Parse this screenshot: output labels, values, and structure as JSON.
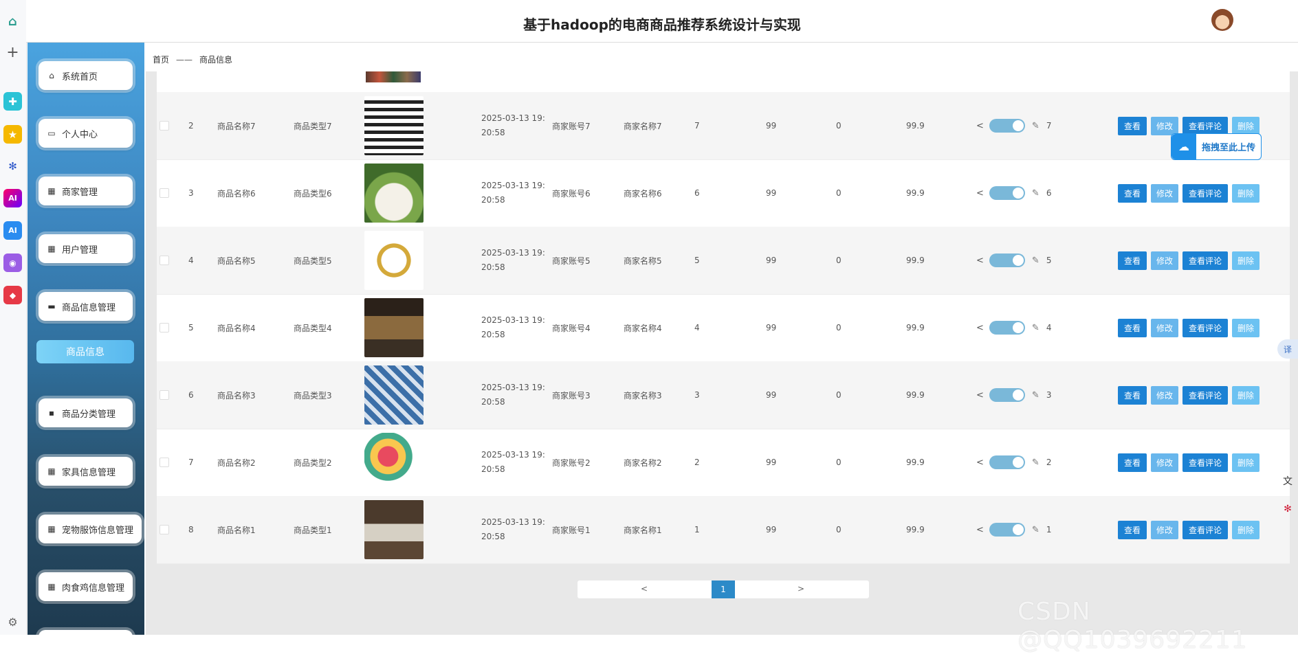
{
  "header": {
    "title": "基于hadoop的电商商品推荐系统设计与实现"
  },
  "sidebar": {
    "items": [
      {
        "label": "系统首页",
        "icon": "home-icon"
      },
      {
        "label": "个人中心",
        "icon": "card-icon"
      },
      {
        "label": "商家管理",
        "icon": "grid-icon"
      },
      {
        "label": "用户管理",
        "icon": "grid-icon"
      },
      {
        "label": "商品信息管理",
        "icon": "briefcase-icon"
      },
      {
        "label": "商品分类管理",
        "icon": "chat-icon"
      },
      {
        "label": "家具信息管理",
        "icon": "grid-icon"
      },
      {
        "label": "宠物服饰信息管理",
        "icon": "grid-icon"
      },
      {
        "label": "肉食鸡信息管理",
        "icon": "grid-icon"
      }
    ],
    "active_sub": "商品信息"
  },
  "breadcrumb": {
    "home": "首页",
    "sep": "——",
    "current": "商品信息"
  },
  "buttons": {
    "view": "查看",
    "edit": "修改",
    "review": "查看评论",
    "delete": "删除"
  },
  "rows": [
    {
      "idx": "2",
      "name": "商品名称7",
      "type": "商品类型7",
      "date": "2025-03-13 19:20:58",
      "account": "商家账号7",
      "merchant": "商家名称7",
      "n1": "7",
      "n2": "99",
      "n3": "0",
      "price": "99.9",
      "likes": "7",
      "img": "dress"
    },
    {
      "idx": "3",
      "name": "商品名称6",
      "type": "商品类型6",
      "date": "2025-03-13 19:20:58",
      "account": "商家账号6",
      "merchant": "商家名称6",
      "n1": "6",
      "n2": "99",
      "n3": "0",
      "price": "99.9",
      "likes": "6",
      "img": "flour"
    },
    {
      "idx": "4",
      "name": "商品名称5",
      "type": "商品类型5",
      "date": "2025-03-13 19:20:58",
      "account": "商家账号5",
      "merchant": "商家名称5",
      "n1": "5",
      "n2": "99",
      "n3": "0",
      "price": "99.9",
      "likes": "5",
      "img": "bracelet"
    },
    {
      "idx": "5",
      "name": "商品名称4",
      "type": "商品类型4",
      "date": "2025-03-13 19:20:58",
      "account": "商家账号4",
      "merchant": "商家名称4",
      "n1": "4",
      "n2": "99",
      "n3": "0",
      "price": "99.9",
      "likes": "4",
      "img": "store"
    },
    {
      "idx": "6",
      "name": "商品名称3",
      "type": "商品类型3",
      "date": "2025-03-13 19:20:58",
      "account": "商家账号3",
      "merchant": "商家名称3",
      "n1": "3",
      "n2": "99",
      "n3": "0",
      "price": "99.9",
      "likes": "3",
      "img": "blue"
    },
    {
      "idx": "7",
      "name": "商品名称2",
      "type": "商品类型2",
      "date": "2025-03-13 19:20:58",
      "account": "商家账号2",
      "merchant": "商家名称2",
      "n1": "2",
      "n2": "99",
      "n3": "0",
      "price": "99.9",
      "likes": "2",
      "img": "candy"
    },
    {
      "idx": "8",
      "name": "商品名称1",
      "type": "商品类型1",
      "date": "2025-03-13 19:20:58",
      "account": "商家账号1",
      "merchant": "商家名称1",
      "n1": "1",
      "n2": "99",
      "n3": "0",
      "price": "99.9",
      "likes": "1",
      "img": "tea"
    }
  ],
  "pagination": {
    "prev": "<",
    "current": "1",
    "next": ">"
  },
  "upload_widget": {
    "label": "拖拽至此上传"
  },
  "watermark": "CSDN @QQ1039692211",
  "colors": {
    "primary": "#1c82d4",
    "light": "#68b6ec",
    "toggle": "#7ab8d9"
  }
}
